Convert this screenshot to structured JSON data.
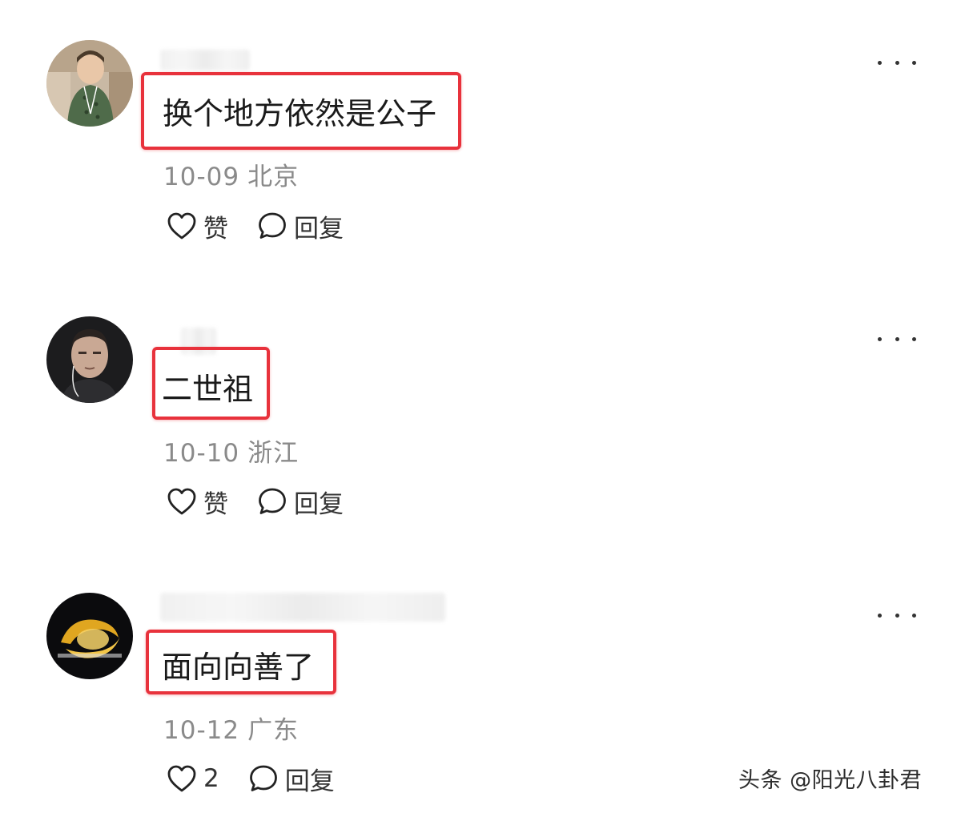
{
  "comments": [
    {
      "text": "换个地方依然是公子",
      "date": "10-09",
      "location": "北京",
      "like_label": "赞",
      "reply_label": "回复"
    },
    {
      "text": "二世祖",
      "date": "10-10",
      "location": "浙江",
      "like_label": "赞",
      "reply_label": "回复"
    },
    {
      "text": "面向向善了",
      "date": "10-12",
      "location": "广东",
      "like_label": "2",
      "reply_label": "回复"
    }
  ],
  "watermark": "头条 @阳光八卦君",
  "icons": {
    "like": "heart-icon",
    "reply": "speech-bubble-icon",
    "more": "more-dots-icon"
  },
  "colors": {
    "highlight": "#e8323c",
    "meta_text": "#8a8a8a"
  }
}
